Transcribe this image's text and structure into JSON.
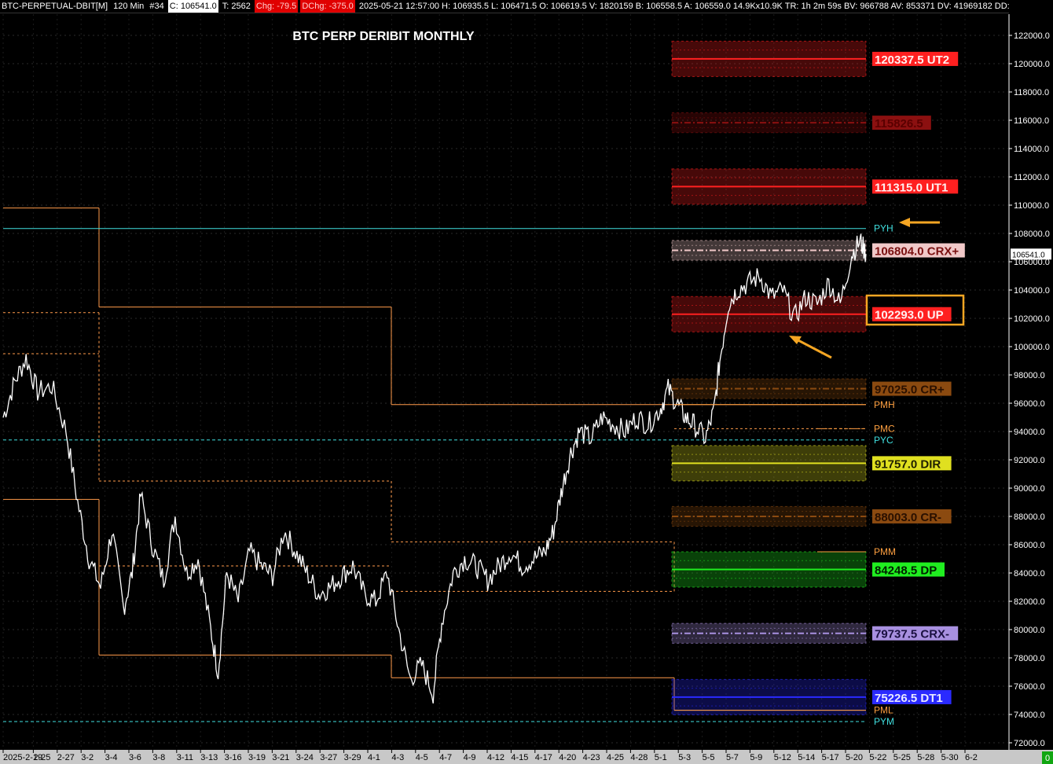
{
  "infobar": {
    "symbol": "BTC-PERPETUAL-DBIT[M]",
    "interval": "120 Min",
    "bar": "#34",
    "close": "C: 106541.0",
    "ticks": "T: 2562",
    "chg": "Chg: -79.5",
    "dchg": "DChg: -375.0",
    "rest": "2025-05-21 12:57:00 H: 106935.5 L: 106471.5 O: 106619.5 V: 1820159 B: 106558.5 A: 106559.0 14.9Kx10.9K TR: 1h 2m 59s BV: 966788 AV: 853371 DV: 41969182 DD: -("
  },
  "chart_data": {
    "type": "line",
    "title": "BTC PERP DERIBIT MONTHLY",
    "ylim": [
      71500,
      123500
    ],
    "yticks": [
      "122000.0",
      "120000.0",
      "118000.0",
      "116000.0",
      "114000.0",
      "112000.0",
      "110000.0",
      "108000.0",
      "106000.0",
      "104000.0",
      "102000.0",
      "100000.0",
      "98000.0",
      "96000.0",
      "94000.0",
      "92000.0",
      "90000.0",
      "88000.0",
      "86000.0",
      "84000.0",
      "82000.0",
      "80000.0",
      "78000.0",
      "76000.0",
      "74000.0",
      "72000.0"
    ],
    "xticks": [
      "2025-2-19",
      "2-25",
      "2-27",
      "3-2",
      "3-4",
      "3-6",
      "3-8",
      "3-11",
      "3-13",
      "3-16",
      "3-19",
      "3-21",
      "3-24",
      "3-27",
      "3-29",
      "4-1",
      "4-3",
      "4-5",
      "4-7",
      "4-9",
      "4-12",
      "4-15",
      "4-17",
      "4-20",
      "4-23",
      "4-25",
      "4-28",
      "5-1",
      "5-3",
      "5-5",
      "5-7",
      "5-9",
      "5-12",
      "5-14",
      "5-17",
      "5-20",
      "5-22",
      "5-25",
      "5-28",
      "5-30",
      "6-2"
    ],
    "last_price": "106541.0",
    "price_path": [
      [
        0,
        95000
      ],
      [
        4,
        97500
      ],
      [
        8,
        99200
      ],
      [
        12,
        96800
      ],
      [
        17,
        97200
      ],
      [
        22,
        94000
      ],
      [
        26,
        89000
      ],
      [
        30,
        85000
      ],
      [
        34,
        83000
      ],
      [
        38,
        87000
      ],
      [
        42,
        81500
      ],
      [
        45,
        84000
      ],
      [
        48,
        89500
      ],
      [
        52,
        86000
      ],
      [
        56,
        83500
      ],
      [
        60,
        88000
      ],
      [
        64,
        84000
      ],
      [
        68,
        85000
      ],
      [
        72,
        80500
      ],
      [
        75,
        77000
      ],
      [
        78,
        84000
      ],
      [
        82,
        82000
      ],
      [
        86,
        85500
      ],
      [
        90,
        84500
      ],
      [
        94,
        83800
      ],
      [
        98,
        87000
      ],
      [
        102,
        85500
      ],
      [
        106,
        84000
      ],
      [
        110,
        82500
      ],
      [
        114,
        83000
      ],
      [
        118,
        83800
      ],
      [
        122,
        84500
      ],
      [
        126,
        82500
      ],
      [
        130,
        82000
      ],
      [
        134,
        84000
      ],
      [
        138,
        80000
      ],
      [
        142,
        76500
      ],
      [
        146,
        77500
      ],
      [
        150,
        75500
      ],
      [
        153,
        80500
      ],
      [
        157,
        84000
      ],
      [
        161,
        85000
      ],
      [
        165,
        84500
      ],
      [
        169,
        83500
      ],
      [
        173,
        84500
      ],
      [
        177,
        85500
      ],
      [
        181,
        84500
      ],
      [
        185,
        85000
      ],
      [
        189,
        85500
      ],
      [
        192,
        87000
      ],
      [
        195,
        90000
      ],
      [
        198,
        92500
      ],
      [
        201,
        94000
      ],
      [
        205,
        93500
      ],
      [
        209,
        95000
      ],
      [
        213,
        94500
      ],
      [
        217,
        94000
      ],
      [
        221,
        95000
      ],
      [
        225,
        94500
      ],
      [
        229,
        95500
      ],
      [
        232,
        97000
      ],
      [
        235,
        96000
      ],
      [
        238,
        95000
      ],
      [
        241,
        94500
      ],
      [
        245,
        93500
      ],
      [
        248,
        95500
      ],
      [
        250,
        99000
      ],
      [
        253,
        103000
      ],
      [
        256,
        104000
      ],
      [
        260,
        104500
      ],
      [
        264,
        105000
      ],
      [
        268,
        103500
      ],
      [
        272,
        104000
      ],
      [
        276,
        102000
      ],
      [
        280,
        103500
      ],
      [
        284,
        103000
      ],
      [
        288,
        104500
      ],
      [
        292,
        103000
      ],
      [
        296,
        106500
      ],
      [
        299,
        107500
      ],
      [
        301,
        106541
      ]
    ],
    "levels": [
      {
        "value": 120337.5,
        "label": "120337.5 UT2",
        "color": "#ff2020",
        "band": 2500,
        "text_color": "#fff0f0"
      },
      {
        "value": 115826.5,
        "label": "115826.5",
        "color": "#8b1010",
        "band": 1400,
        "text_color": "#5a0000"
      },
      {
        "value": 111315.0,
        "label": "111315.0 UT1",
        "color": "#ff2020",
        "band": 2500,
        "text_color": "#fff0f0"
      },
      {
        "value": 106804.0,
        "label": "106804.0 CRX+",
        "color": "#f0c8c8",
        "band": 1400,
        "text_color": "#7a1010"
      },
      {
        "value": 102293.0,
        "label": "102293.0 UP",
        "color": "#ff2020",
        "band": 2500,
        "text_color": "#fff0f0"
      },
      {
        "value": 97025.0,
        "label": "97025.0 CR+",
        "color": "#8b4a10",
        "band": 1400,
        "text_color": "#2a1000"
      },
      {
        "value": 91757.0,
        "label": "91757.0 DIR",
        "color": "#e0e020",
        "band": 2500,
        "text_color": "#202000"
      },
      {
        "value": 88003.0,
        "label": "88003.0 CR-",
        "color": "#8b4a10",
        "band": 1400,
        "text_color": "#2a1000"
      },
      {
        "value": 84248.5,
        "label": "84248.5 DP",
        "color": "#20ee20",
        "band": 2500,
        "text_color": "#002000"
      },
      {
        "value": 79737.5,
        "label": "79737.5 CRX-",
        "color": "#a890e0",
        "band": 1400,
        "text_color": "#1a1040"
      },
      {
        "value": 75226.5,
        "label": "75226.5 DT1",
        "color": "#2a2aff",
        "band": 2500,
        "text_color": "#e8e8ff"
      }
    ],
    "markers": [
      {
        "label": "PYH",
        "value": 108350,
        "color": "#40e0e0"
      },
      {
        "label": "PMH",
        "value": 95900,
        "color": "#ffa040"
      },
      {
        "label": "PMC",
        "value": 94200,
        "color": "#ffa040"
      },
      {
        "label": "PYC",
        "value": 93400,
        "color": "#40e0e0"
      },
      {
        "label": "PMM",
        "value": 85500,
        "color": "#ffa040"
      },
      {
        "label": "PML",
        "value": 74300,
        "color": "#ffa040"
      },
      {
        "label": "PYM",
        "value": 73500,
        "color": "#40e0e0"
      }
    ],
    "corner_value": "0"
  },
  "colors": {
    "accent": "#f5a623",
    "orange_line": "#ff9a4a",
    "cyan_line": "#40e0e0"
  }
}
